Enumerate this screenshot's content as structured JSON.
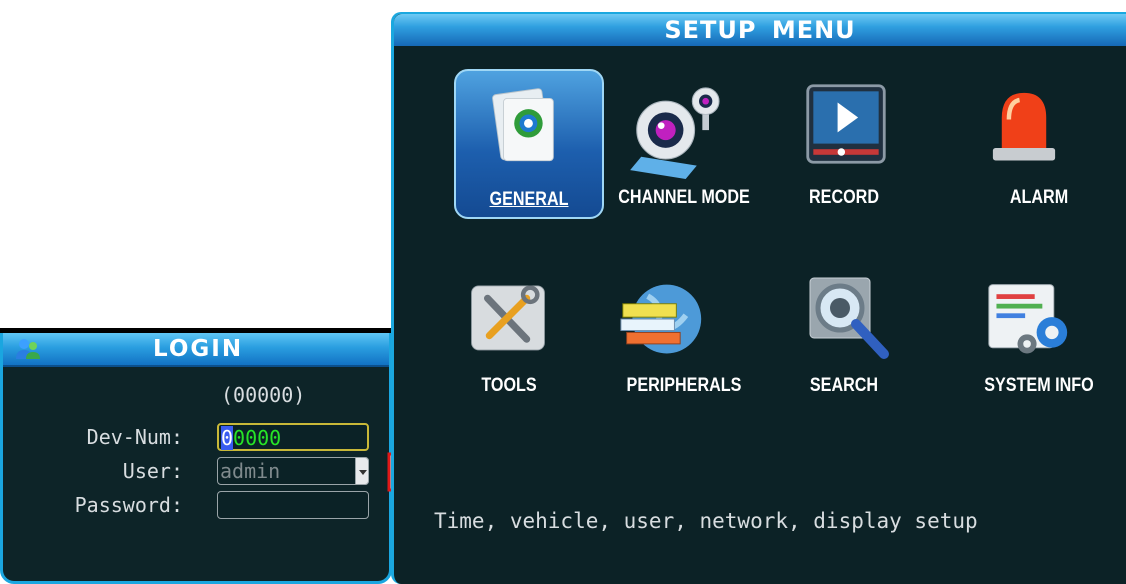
{
  "login": {
    "title": "LOGIN",
    "device_hint": "(00000)",
    "dev_num_label": "Dev-Num:",
    "dev_num_cursor": "0",
    "dev_num_rest": "0000",
    "user_label": "User:",
    "user_value": "admin",
    "password_label": "Password:",
    "password_value": ""
  },
  "setup": {
    "title": "SETUP MENU",
    "items": [
      {
        "label": "GENERAL",
        "icon": "settings-document-icon",
        "selected": true
      },
      {
        "label": "CHANNEL MODE",
        "icon": "webcam-icon"
      },
      {
        "label": "RECORD",
        "icon": "video-play-icon"
      },
      {
        "label": "ALARM",
        "icon": "siren-icon"
      },
      {
        "label": "TOOLS",
        "icon": "tools-icon"
      },
      {
        "label": "PERIPHERALS",
        "icon": "peripherals-globe-icon"
      },
      {
        "label": "SEARCH",
        "icon": "magnifier-icon"
      },
      {
        "label": "SYSTEM INFO",
        "icon": "system-info-icon"
      }
    ],
    "description": "Time, vehicle, user, network, display setup"
  },
  "colors": {
    "panel_bg": "#0c2226",
    "titlebar": "#2a9ee0",
    "border": "#1ba8df",
    "selected": "#1d5fae",
    "input_text": "#27e427"
  }
}
